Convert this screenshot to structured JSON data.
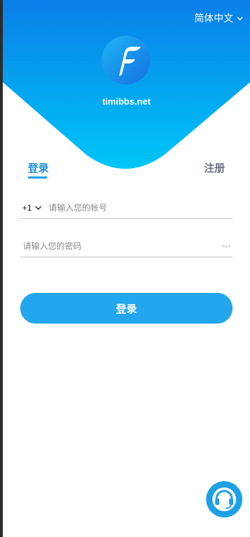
{
  "header": {
    "language": "简体中文",
    "site_name": "timibbs.net",
    "gradient_top": "#0a7fe8",
    "gradient_bottom": "#00c6f7"
  },
  "tabs": {
    "login": "登录",
    "register": "注册"
  },
  "form": {
    "country_code": "+1",
    "account_placeholder": "请输入您的帐号",
    "password_placeholder": "请输入您的密码",
    "submit_label": "登录"
  },
  "icons": {
    "language_dropdown": "chevron-down-icon",
    "country_dropdown": "chevron-down-icon",
    "password_visibility": "eye-closed-icon",
    "support": "headset-icon",
    "logo": "f-logo-icon"
  },
  "colors": {
    "accent": "#23a6ee",
    "tab_active": "#1e90d8",
    "tab_inactive": "#6b7280"
  }
}
